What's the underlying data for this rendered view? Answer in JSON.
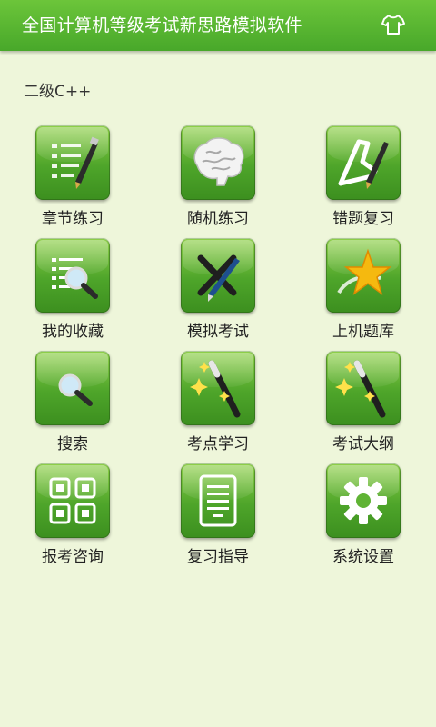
{
  "header": {
    "title": "全国计算机等级考试新思路模拟软件",
    "skin_icon": "tshirt-icon"
  },
  "subject": "二级C++",
  "menu": [
    {
      "label": "章节练习",
      "icon": "checklist-pen-icon"
    },
    {
      "label": "随机练习",
      "icon": "brain-icon"
    },
    {
      "label": "错题复习",
      "icon": "triangle-pen-icon"
    },
    {
      "label": "我的收藏",
      "icon": "list-magnifier-icon"
    },
    {
      "label": "模拟考试",
      "icon": "pens-cross-icon"
    },
    {
      "label": "上机题库",
      "icon": "shooting-star-icon"
    },
    {
      "label": "搜索",
      "icon": "magnifier-icon"
    },
    {
      "label": "考点学习",
      "icon": "magic-wand-icon"
    },
    {
      "label": "考试大纲",
      "icon": "magic-wand-icon"
    },
    {
      "label": "报考咨询",
      "icon": "grid-icon"
    },
    {
      "label": "复习指导",
      "icon": "document-icon"
    },
    {
      "label": "系统设置",
      "icon": "gear-icon"
    }
  ],
  "colors": {
    "header": "#5bb733",
    "background": "#eef6da",
    "tile": "#5fb334"
  }
}
